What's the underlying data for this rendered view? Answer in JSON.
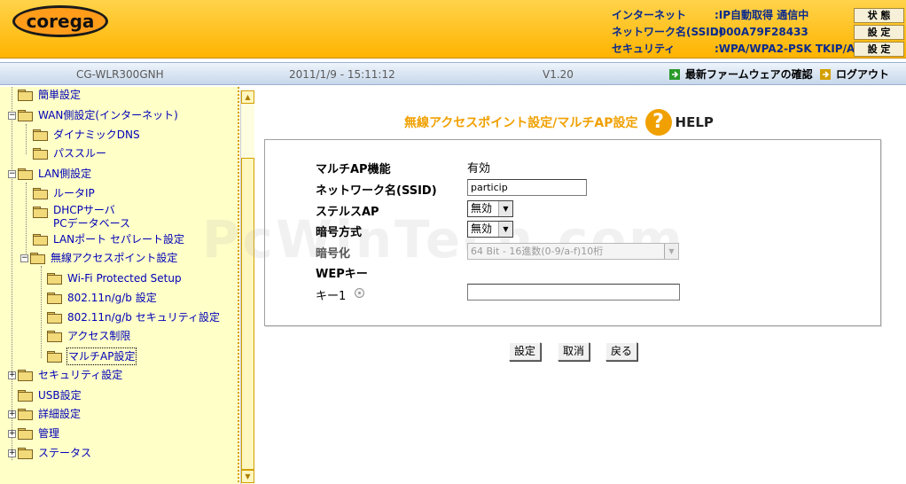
{
  "brand": {
    "logo_text": "corega"
  },
  "status": {
    "rows": [
      {
        "label": "インターネット",
        "value": ":IP自動取得 通信中",
        "button": "状 態"
      },
      {
        "label": "ネットワーク名(SSID)",
        "value": ":000A79F28433",
        "button": "設 定"
      },
      {
        "label": "セキュリティ",
        "value": ":WPA/WPA2-PSK TKIP/AES",
        "button": "設 定"
      }
    ]
  },
  "subbar": {
    "model": "CG-WLR300GNH",
    "datetime": "2011/1/9 - 15:11:12",
    "version": "V1.20",
    "firmware_link": "最新ファームウェアの確認",
    "logout_link": "ログアウト"
  },
  "tree": {
    "items": [
      {
        "label": "簡単設定"
      },
      {
        "label": "WAN側設定(インターネット)",
        "expander": "−"
      },
      {
        "label": "ダイナミックDNS"
      },
      {
        "label": "パススルー"
      },
      {
        "label": "LAN側設定",
        "expander": "−"
      },
      {
        "label": "ルータIP"
      },
      {
        "label": "DHCPサーバ"
      },
      {
        "label": "PCデータベース"
      },
      {
        "label": "LANポート セパレート設定"
      },
      {
        "label": "無線アクセスポイント設定",
        "expander": "−"
      },
      {
        "label": "Wi-Fi Protected Setup"
      },
      {
        "label": "802.11n/g/b 設定"
      },
      {
        "label": "802.11n/g/b セキュリティ設定"
      },
      {
        "label": "アクセス制限"
      },
      {
        "label": "マルチAP設定",
        "selected": true
      },
      {
        "label": "セキュリティ設定",
        "expander": "+"
      },
      {
        "label": "USB設定"
      },
      {
        "label": "詳細設定",
        "expander": "+"
      },
      {
        "label": "管理",
        "expander": "+"
      },
      {
        "label": "ステータス",
        "expander": "+"
      }
    ]
  },
  "scrollbar": {
    "up": "▲",
    "down": "▼"
  },
  "page": {
    "title": "無線アクセスポイント設定/マルチAP設定",
    "help_icon": "?",
    "help_label": "HELP"
  },
  "form": {
    "multi_ap_label": "マルチAP機能",
    "multi_ap_value": "有効",
    "ssid_label": "ネットワーク名(SSID)",
    "ssid_value": "particip",
    "stealth_label": "ステルスAP",
    "stealth_value": "無効",
    "cipher_label": "暗号方式",
    "cipher_value": "無効",
    "encryption_label": "暗号化",
    "encryption_value": "64 Bit - 16進数(0-9/a-f)10桁",
    "wep_label": "WEPキー",
    "key1_label": "キー1",
    "key1_value": ""
  },
  "buttons": {
    "save": "設定",
    "cancel": "取消",
    "back": "戻る"
  },
  "watermark": "PcWinTech.com",
  "colors": {
    "header": "#ffb400",
    "title": "#f0a000",
    "tree_link": "#0000b8",
    "sidebar_bg": "#ffffc8"
  }
}
